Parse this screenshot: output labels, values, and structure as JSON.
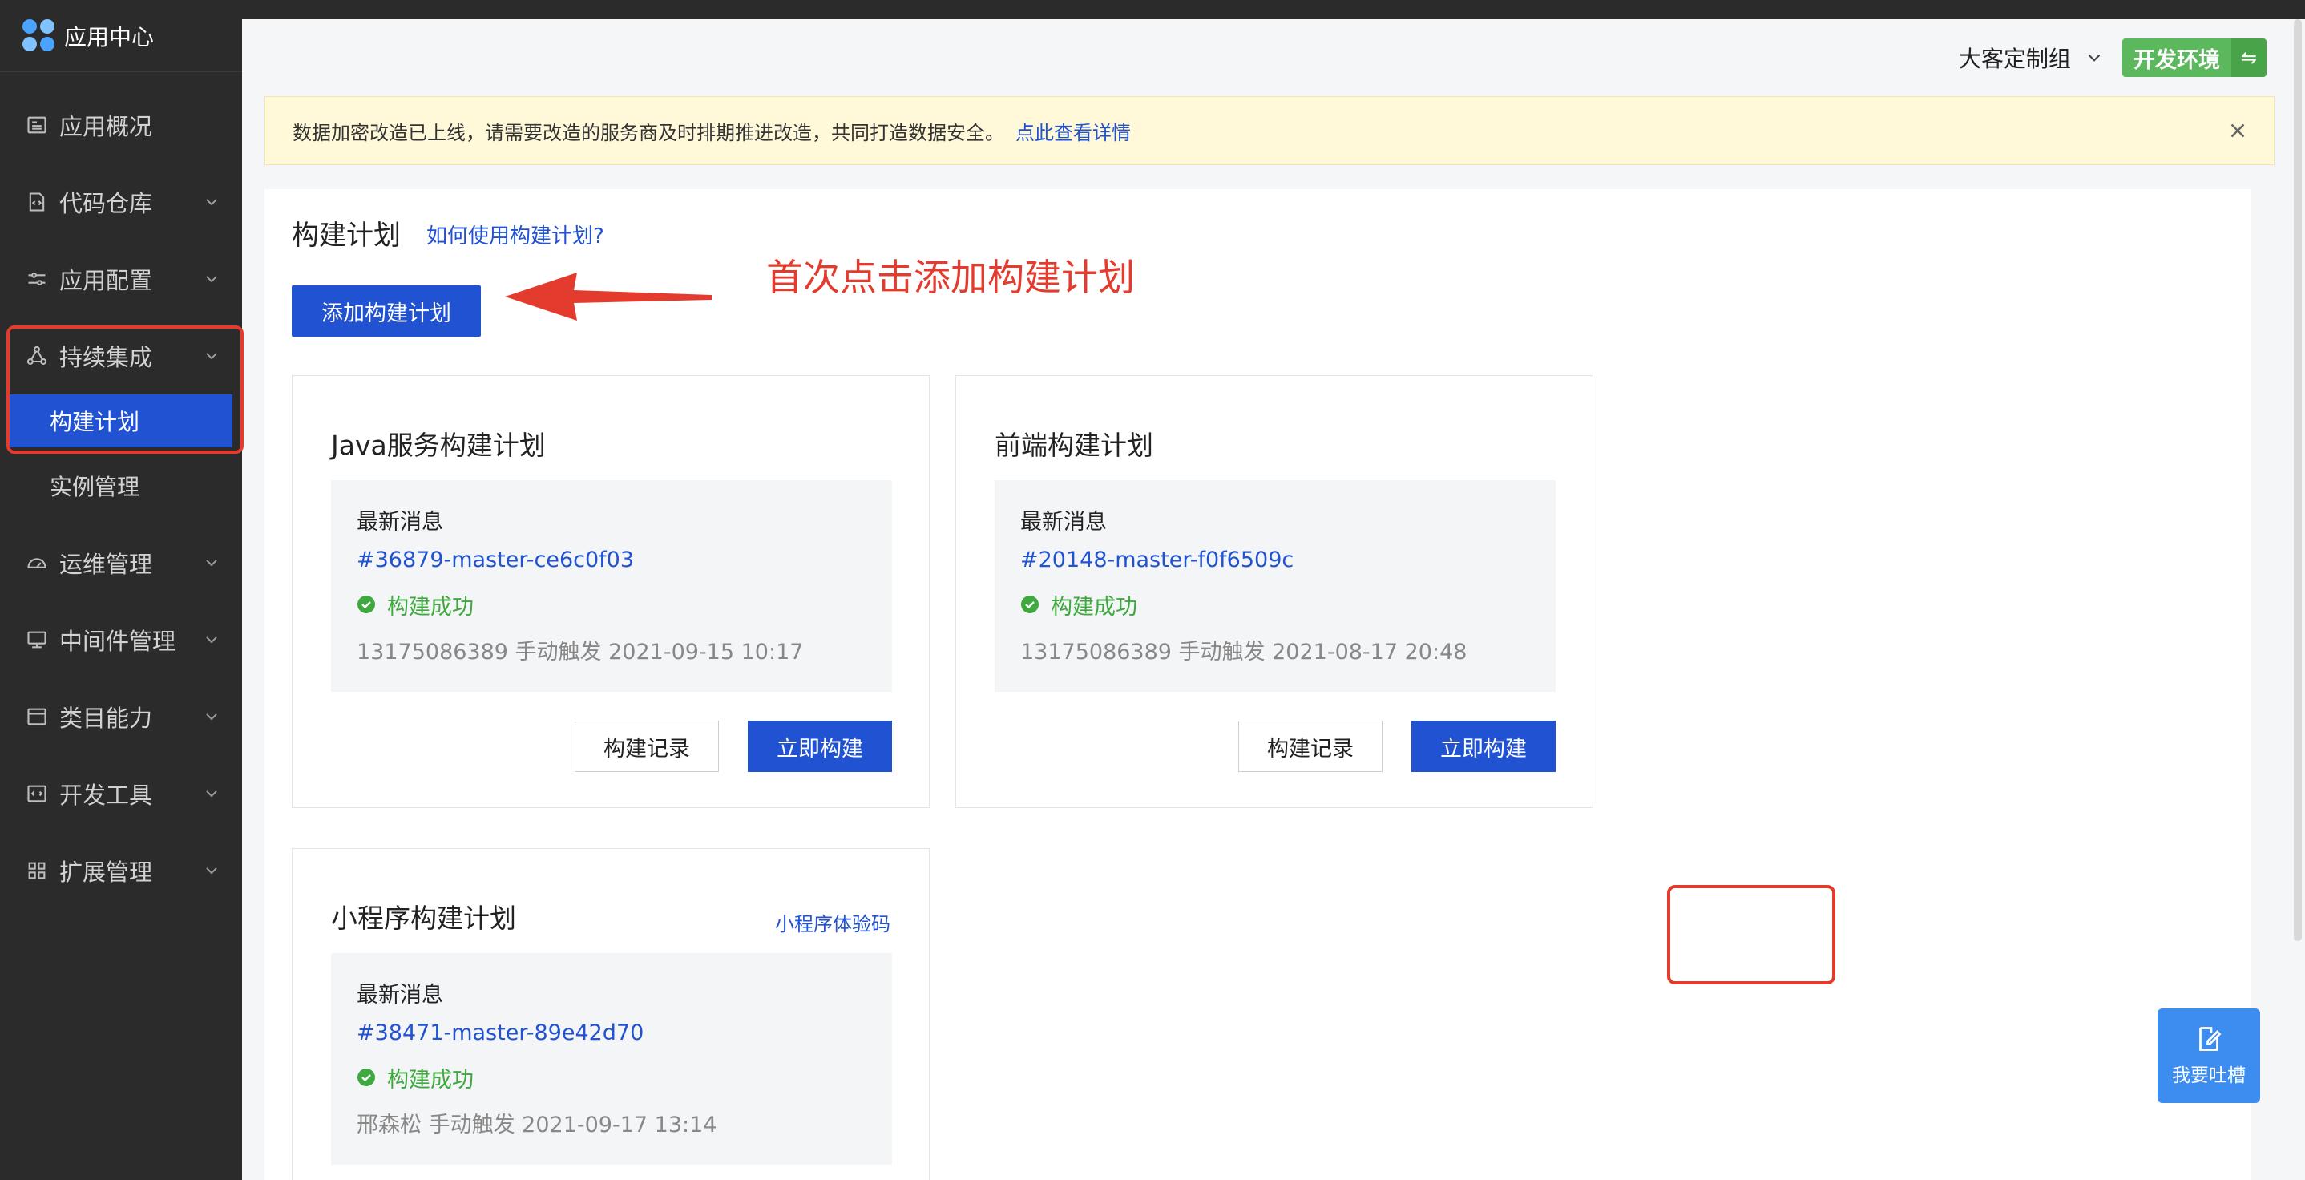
{
  "app": {
    "title": "应用中心"
  },
  "sidebar": {
    "items": [
      {
        "label": "应用概况",
        "icon": "overview-icon"
      },
      {
        "label": "代码仓库",
        "icon": "code-repo-icon"
      },
      {
        "label": "应用配置",
        "icon": "sliders-icon"
      },
      {
        "label": "持续集成",
        "icon": "ci-nodes-icon"
      },
      {
        "label": "构建计划"
      },
      {
        "label": "实例管理"
      },
      {
        "label": "运维管理",
        "icon": "gauge-icon"
      },
      {
        "label": "中间件管理",
        "icon": "server-icon"
      },
      {
        "label": "类目能力",
        "icon": "category-icon"
      },
      {
        "label": "开发工具",
        "icon": "dev-tools-icon"
      },
      {
        "label": "扩展管理",
        "icon": "grid-icon"
      }
    ]
  },
  "header": {
    "team": "大客定制组",
    "env": "开发环境"
  },
  "notice": {
    "text": "数据加密改造已上线，请需要改造的服务商及时排期推进改造，共同打造数据安全。",
    "link": "点此查看详情"
  },
  "main": {
    "title": "构建计划",
    "help_link": "如何使用构建计划?",
    "add_button": "添加构建计划",
    "hint": "首次点击添加构建计划",
    "cards": [
      {
        "title": "Java服务构建计划",
        "msg_head": "最新消息",
        "msg_id": "#36879-master-ce6c0f03",
        "status": "构建成功",
        "meta": "13175086389 手动触发 2021-09-15 10:17",
        "record_btn": "构建记录",
        "build_btn": "立即构建"
      },
      {
        "title": "前端构建计划",
        "msg_head": "最新消息",
        "msg_id": "#20148-master-f0f6509c",
        "status": "构建成功",
        "meta": "13175086389 手动触发 2021-08-17 20:48",
        "record_btn": "构建记录",
        "build_btn": "立即构建"
      },
      {
        "title": "小程序构建计划",
        "link": "小程序体验码",
        "msg_head": "最新消息",
        "msg_id": "#38471-master-89e42d70",
        "status": "构建成功",
        "meta": "邢森松 手动触发 2021-09-17 13:14"
      }
    ]
  },
  "feedback": {
    "label": "我要吐槽"
  },
  "colors": {
    "primary": "#2152d1",
    "sidebar": "#2b2b2b",
    "success": "#3fa83f",
    "annotation": "#e33b2d",
    "env": "#5cb85c"
  }
}
